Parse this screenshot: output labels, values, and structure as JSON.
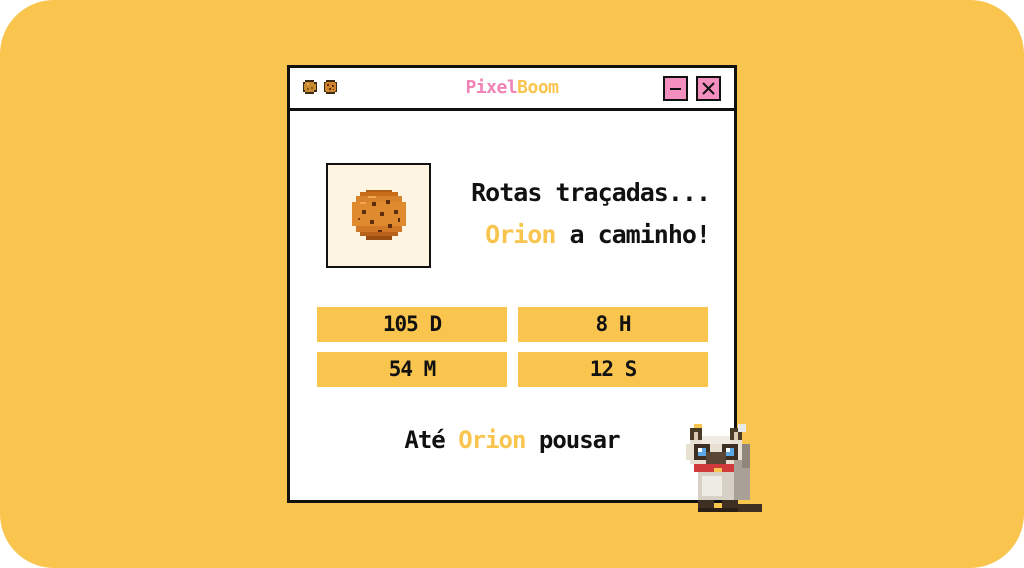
{
  "window": {
    "title_part1": "Pixel",
    "title_part2": "Boom",
    "minimize_symbol": "–",
    "close_symbol": "×",
    "title_icons": [
      "potato-icon",
      "cookie-icon"
    ]
  },
  "message": {
    "line1": "Rotas traçadas...",
    "line2_highlight": "Orion",
    "line2_rest": " a caminho!"
  },
  "countdown": {
    "days": "105 D",
    "hours": "8 H",
    "minutes": "54 M",
    "seconds": "12 S"
  },
  "footer": {
    "prefix": "Até ",
    "highlight": "Orion",
    "suffix": " pousar"
  },
  "colors": {
    "background": "#f9c54e",
    "accent_yellow": "#f9c54e",
    "accent_pink": "#f083b6",
    "button_pink": "#f38fbe",
    "text": "#111111",
    "window": "#ffffff",
    "cookie_box": "#fdf5e1"
  },
  "illustrations": [
    "cookie-illustration",
    "pixel-cat-mascot"
  ]
}
